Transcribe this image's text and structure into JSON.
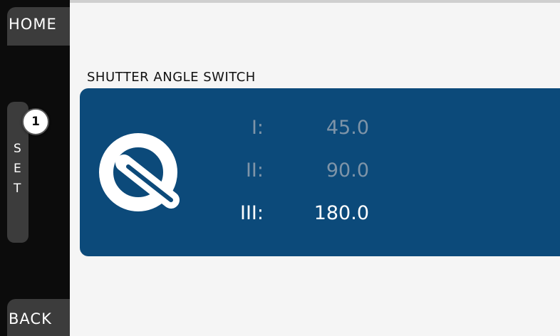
{
  "sidebar": {
    "home_label": "HOME",
    "set_letters": [
      "S",
      "E",
      "T"
    ],
    "back_label": "BACK",
    "badge": "1"
  },
  "main": {
    "title": "SHUTTER ANGLE SWITCH",
    "icon": "shutter-angle-icon",
    "options": [
      {
        "label": "I:",
        "value": "45.0",
        "selected": false
      },
      {
        "label": "II:",
        "value": "90.0",
        "selected": false
      },
      {
        "label": "III:",
        "value": "180.0",
        "selected": true
      }
    ]
  },
  "colors": {
    "panel": "#0c4a7a",
    "sidebar": "#0c0c0c",
    "button": "#3c3c3c",
    "dim_text": "#7e94a8",
    "active_text": "#ffffff"
  }
}
